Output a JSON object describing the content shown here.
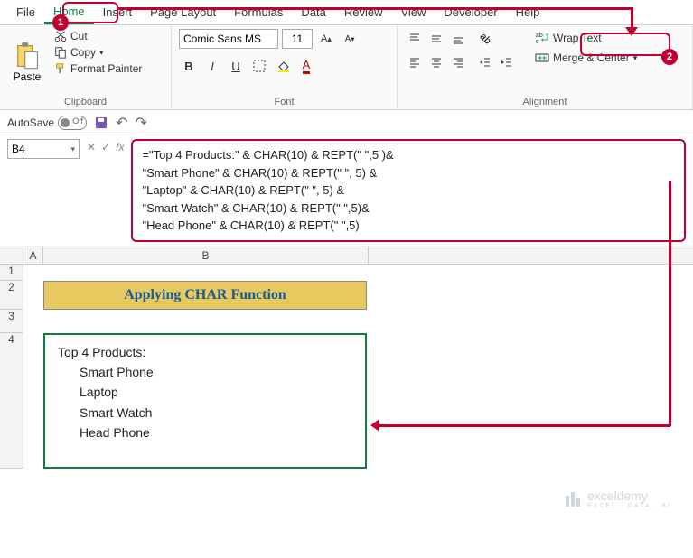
{
  "tabs": [
    "File",
    "Home",
    "Insert",
    "Page Layout",
    "Formulas",
    "Data",
    "Review",
    "View",
    "Developer",
    "Help"
  ],
  "active_tab": "Home",
  "clipboard": {
    "group_label": "Clipboard",
    "paste": "Paste",
    "cut": "Cut",
    "copy": "Copy",
    "format_painter": "Format Painter"
  },
  "font": {
    "group_label": "Font",
    "name": "Comic Sans MS",
    "size": "11",
    "bold": "B",
    "italic": "I",
    "underline": "U"
  },
  "alignment": {
    "group_label": "Alignment",
    "wrap_text": "Wrap Text",
    "merge_center": "Merge & Center"
  },
  "qat": {
    "autosave_label": "AutoSave",
    "autosave_state": "Off"
  },
  "namebox": "B4",
  "formula_lines": [
    "=\"Top 4 Products:\" & CHAR(10) & REPT(\" \",5 )&",
    " \"Smart Phone\" & CHAR(10) & REPT(\" \", 5) &",
    " \"Laptop\" & CHAR(10) & REPT(\" \", 5) &",
    "\"Smart Watch\" & CHAR(10) & REPT(\" \",5)&",
    "\"Head Phone\" & CHAR(10) & REPT(\" \",5)"
  ],
  "columns": {
    "A": "A",
    "B": "B"
  },
  "row_labels": [
    "1",
    "2",
    "3",
    "4"
  ],
  "b2_text": "Applying CHAR Function",
  "b4": {
    "heading": "Top 4 Products:",
    "items": [
      "Smart Phone",
      "Laptop",
      "Smart Watch",
      "Head Phone"
    ]
  },
  "watermark": {
    "brand": "exceldemy",
    "tagline": "EXCEL · DATA · BI"
  },
  "markers": {
    "m1": "1",
    "m2": "2"
  }
}
